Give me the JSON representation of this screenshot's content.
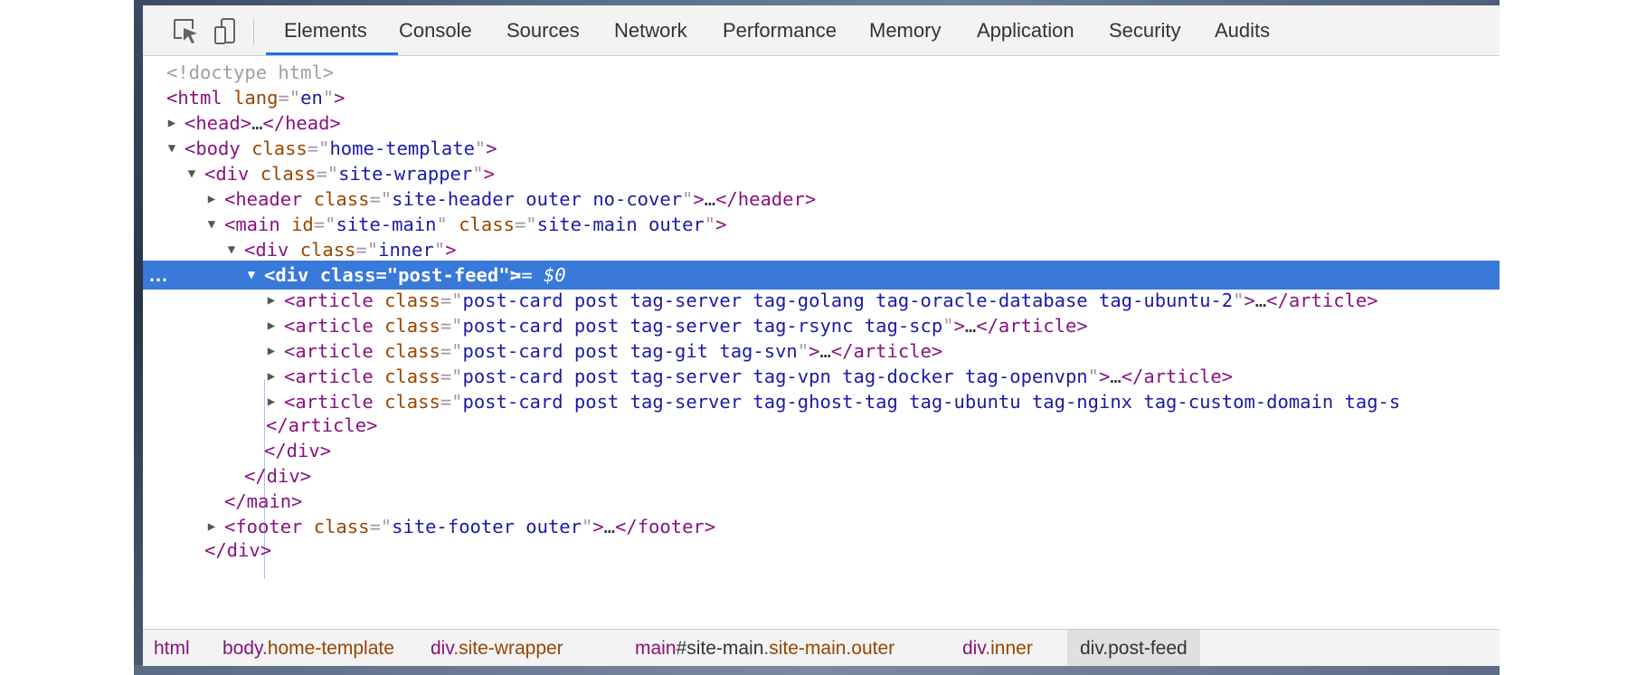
{
  "toolbar": {
    "tabs": [
      "Elements",
      "Console",
      "Sources",
      "Network",
      "Performance",
      "Memory",
      "Application",
      "Security",
      "Audits"
    ],
    "icons": [
      "inspect-element-icon",
      "device-toolbar-icon"
    ],
    "active_tab": "Elements",
    "accent_color": "#1a73e8"
  },
  "dom": {
    "doctype": "<!doctype html>",
    "html_open": {
      "tag": "html",
      "attr": "lang",
      "val": "en"
    },
    "head": {
      "tag": "head",
      "ellipsis": "…"
    },
    "body": {
      "tag": "body",
      "attr": "class",
      "val": "home-template"
    },
    "site_wrapper": {
      "tag": "div",
      "attr": "class",
      "val": "site-wrapper"
    },
    "header": {
      "tag": "header",
      "attr": "class",
      "val": "site-header outer no-cover",
      "ellipsis": "…"
    },
    "main": {
      "tag": "main",
      "attr1": "id",
      "val1": "site-main",
      "attr2": "class",
      "val2": "site-main outer"
    },
    "inner": {
      "tag": "div",
      "attr": "class",
      "val": "inner"
    },
    "post_feed": {
      "tag": "div",
      "attr": "class",
      "val": "post-feed",
      "marker": "== $0",
      "dots": "…"
    },
    "articles": [
      {
        "tag": "article",
        "attr": "class",
        "val": "post-card post tag-server tag-golang tag-oracle-database tag-ubuntu-2",
        "ellipsis": "…",
        "close": "</article>"
      },
      {
        "tag": "article",
        "attr": "class",
        "val": "post-card post tag-server tag-rsync tag-scp",
        "ellipsis": "…",
        "close": "</article>"
      },
      {
        "tag": "article",
        "attr": "class",
        "val": "post-card post tag-git tag-svn",
        "ellipsis": "…",
        "close": "</article>"
      },
      {
        "tag": "article",
        "attr": "class",
        "val": "post-card post tag-server tag-vpn tag-docker tag-openvpn",
        "ellipsis": "…",
        "close": "</article>"
      },
      {
        "tag": "article",
        "attr": "class",
        "val": "post-card post tag-server tag-ghost-tag tag-ubuntu tag-nginx tag-custom-domain tag-s",
        "ellipsis": "",
        "close": ""
      }
    ],
    "close_article": "</article>",
    "close_div1": "</div>",
    "close_div2": "</div>",
    "close_main": "</main>",
    "footer": {
      "tag": "footer",
      "attr": "class",
      "val": "site-footer outer",
      "ellipsis": "…"
    },
    "close_div3": "</div>"
  },
  "breadcrumbs": [
    {
      "tag": "html",
      "rest": ""
    },
    {
      "tag": "body",
      "rest": ".home-template"
    },
    {
      "tag": "div",
      "rest": ".site-wrapper"
    },
    {
      "tag": "main",
      "hash": "#site-main",
      "rest": ".site-main.outer"
    },
    {
      "tag": "div",
      "rest": ".inner"
    },
    {
      "tag": "div",
      "rest": ".post-feed"
    }
  ]
}
